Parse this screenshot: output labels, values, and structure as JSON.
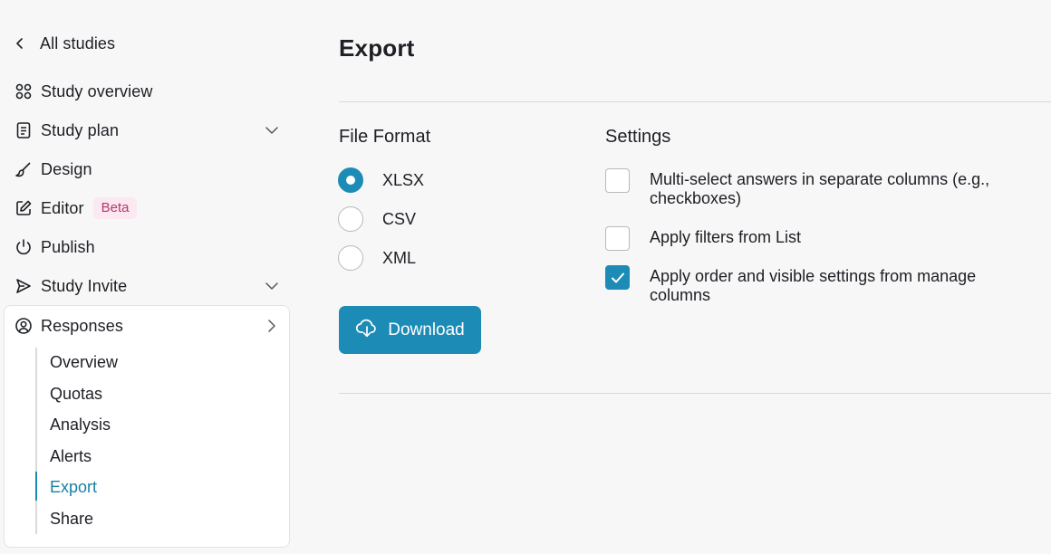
{
  "sidebar": {
    "back_label": "All studies",
    "items": [
      {
        "label": "Study overview"
      },
      {
        "label": "Study plan"
      },
      {
        "label": "Design"
      },
      {
        "label": "Editor",
        "badge": "Beta"
      },
      {
        "label": "Publish"
      },
      {
        "label": "Study Invite"
      }
    ],
    "responses": {
      "label": "Responses",
      "sub_items": [
        "Overview",
        "Quotas",
        "Analysis",
        "Alerts",
        "Export",
        "Share"
      ],
      "active": "Export"
    }
  },
  "main": {
    "title": "Export",
    "file_format": {
      "title": "File Format",
      "options": [
        "XLSX",
        "CSV",
        "XML"
      ],
      "selected": "XLSX"
    },
    "download_label": "Download",
    "settings": {
      "title": "Settings",
      "options": [
        {
          "label": "Multi-select answers in separate columns (e.g., checkboxes)",
          "checked": false
        },
        {
          "label": "Apply filters from List",
          "checked": false
        },
        {
          "label": "Apply order and visible settings from manage columns",
          "checked": true
        }
      ]
    }
  },
  "colors": {
    "accent": "#1c8cb6",
    "active_text": "#1a7fa6",
    "badge_bg": "#fce8f1",
    "badge_text": "#b23a6b",
    "background": "#f7f7f7"
  }
}
